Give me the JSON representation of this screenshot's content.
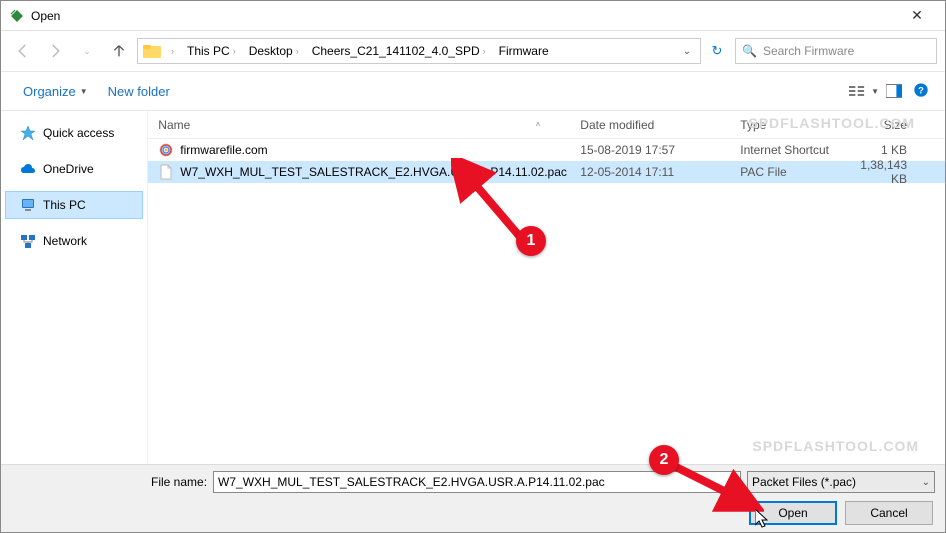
{
  "title": "Open",
  "breadcrumb": [
    "This PC",
    "Desktop",
    "Cheers_C21_141102_4.0_SPD",
    "Firmware"
  ],
  "search_placeholder": "Search Firmware",
  "toolbar": {
    "organize": "Organize",
    "newfolder": "New folder"
  },
  "sidebar": {
    "items": [
      {
        "label": "Quick access"
      },
      {
        "label": "OneDrive"
      },
      {
        "label": "This PC"
      },
      {
        "label": "Network"
      }
    ]
  },
  "columns": {
    "name": "Name",
    "date": "Date modified",
    "type": "Type",
    "size": "Size"
  },
  "files": [
    {
      "name": "firmwarefile.com",
      "date": "15-08-2019 17:57",
      "type": "Internet Shortcut",
      "size": "1 KB"
    },
    {
      "name": "W7_WXH_MUL_TEST_SALESTRACK_E2.HVGA.USR.A.P14.11.02.pac",
      "date": "12-05-2014 17:11",
      "type": "PAC File",
      "size": "1,38,143 KB"
    }
  ],
  "filename_label": "File name:",
  "filename_value": "W7_WXH_MUL_TEST_SALESTRACK_E2.HVGA.USR.A.P14.11.02.pac",
  "filetype": "Packet Files (*.pac)",
  "buttons": {
    "open": "Open",
    "cancel": "Cancel"
  },
  "watermark": "SPDFLASHTOOL.COM",
  "callouts": {
    "one": "1",
    "two": "2"
  }
}
